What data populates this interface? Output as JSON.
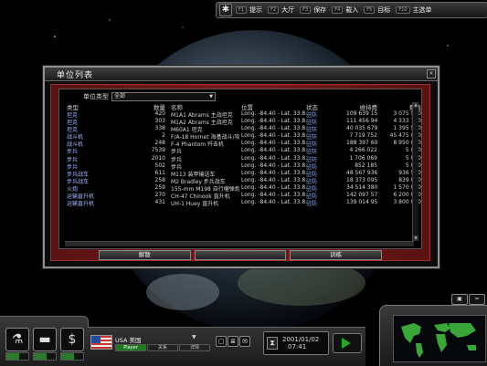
{
  "topbar": {
    "items": [
      {
        "key": "F1",
        "label": "提示"
      },
      {
        "key": "F2",
        "label": "大厅"
      },
      {
        "key": "F3",
        "label": "保存"
      },
      {
        "key": "F4",
        "label": "载入"
      },
      {
        "key": "F5",
        "label": "目标"
      },
      {
        "key": "F10",
        "label": "主选单"
      }
    ]
  },
  "dialog": {
    "title": "单位列表",
    "close": "×",
    "filter_label": "单位类型",
    "filter_value": "全部",
    "columns": [
      "类型",
      "数量",
      "名称",
      "位置",
      "状态",
      "维持费",
      "数值"
    ],
    "rows": [
      {
        "type": "坦克",
        "count": "420",
        "name": "M1A1 Abrams 主战坦克",
        "loc": "Long. -84.40 - Lat. 33.83",
        "status": "驻防",
        "maint": "109 639 156",
        "value": "3 075 500"
      },
      {
        "type": "坦克",
        "count": "303",
        "name": "M1A2 Abrams 主战坦克",
        "loc": "Long. -84.40 - Lat. 33.83",
        "status": "驻防",
        "maint": "111 456 947",
        "value": "4 333 750"
      },
      {
        "type": "坦克",
        "count": "338",
        "name": "M60A1 坦克",
        "loc": "Long. -84.40 - Lat. 33.83",
        "status": "驻防",
        "maint": "40 035 679",
        "value": "1 395 500"
      },
      {
        "type": "战斗机",
        "count": "2",
        "name": "F/A-18 Hornet 海基战斗/攻",
        "loc": "Long. -84.40 - Lat. 33.83",
        "status": "驻防",
        "maint": "7 719 752",
        "value": "45 475 000"
      },
      {
        "type": "战斗机",
        "count": "248",
        "name": "F-4 Phantom 歼击机",
        "loc": "Long. -84.40 - Lat. 33.83",
        "status": "驻防",
        "maint": "188 397 605",
        "value": "8 950 000"
      },
      {
        "type": "步兵",
        "count": "7539",
        "name": "步兵",
        "loc": "Long. -84.40 - Lat. 33.83",
        "status": "驻防",
        "maint": "4 266 022",
        "value": "5 000"
      },
      {
        "type": "步兵",
        "count": "2010",
        "name": "步兵",
        "loc": "Long. -84.40 - Lat. 33.83",
        "status": "驻防",
        "maint": "1 706 069",
        "value": "5 000"
      },
      {
        "type": "步兵",
        "count": "502",
        "name": "步兵",
        "loc": "Long. -84.40 - Lat. 33.83",
        "status": "驻防",
        "maint": "852 185",
        "value": "5 000"
      },
      {
        "type": "步兵战车",
        "count": "611",
        "name": "M113 装甲输送车",
        "loc": "Long. -84.40 - Lat. 33.83",
        "status": "驻防",
        "maint": "48 567 936",
        "value": "936 500"
      },
      {
        "type": "步兵战车",
        "count": "258",
        "name": "M2 Bradley 步兵战车",
        "loc": "Long. -84.40 - Lat. 33.83",
        "status": "驻防",
        "maint": "18 373 095",
        "value": "839 000"
      },
      {
        "type": "火炮",
        "count": "259",
        "name": "155-mm M198 自行榴弹炮",
        "loc": "Long. -84.40 - Lat. 33.83",
        "status": "驻防",
        "maint": "34 514 380",
        "value": "1 570 000"
      },
      {
        "type": "运输直升机",
        "count": "270",
        "name": "CH-47 Chinook 直升机",
        "loc": "Long. -84.40 - Lat. 33.83",
        "status": "驻防",
        "maint": "142 097 579",
        "value": "6 200 000"
      },
      {
        "type": "运输直升机",
        "count": "431",
        "name": "UH-1 Huey 直升机",
        "loc": "Long. -84.40 - Lat. 33.83",
        "status": "驻防",
        "maint": "139 014 956",
        "value": "3 800 000"
      }
    ],
    "buttons": {
      "disband": "解散",
      "middle": "",
      "train": "训练"
    }
  },
  "bottom": {
    "country": "USA 美国",
    "tabs": [
      "Player",
      "关系",
      "详情"
    ],
    "date": "2001/01/02",
    "time": "07:41"
  },
  "colors": {
    "accent_green": "#2aa52a",
    "frame_red": "#7a1a1a",
    "link_blue": "#8fb3ff"
  }
}
